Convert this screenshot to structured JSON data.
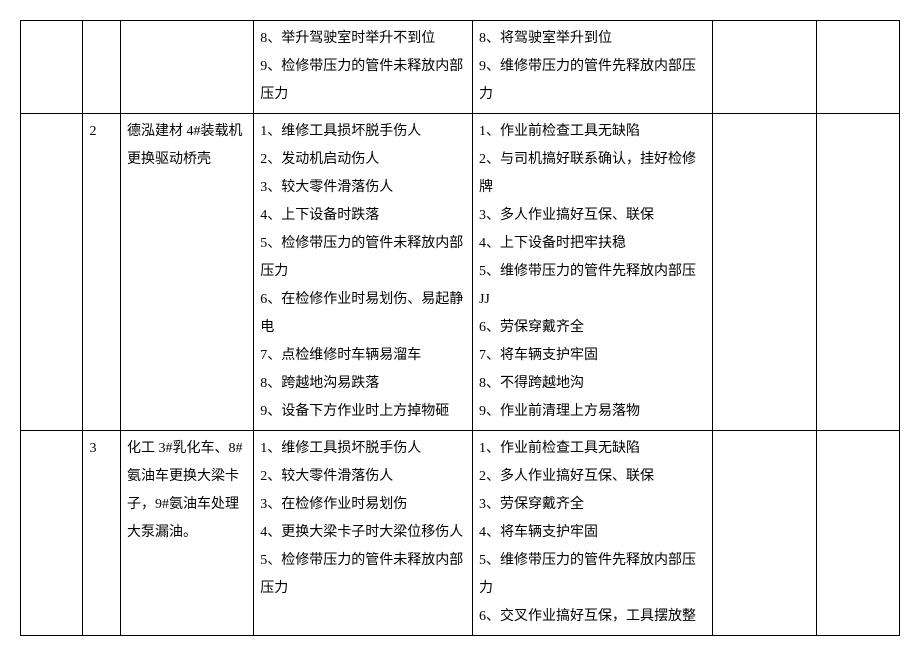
{
  "rows": [
    {
      "c0": "",
      "c1": "",
      "c2": "",
      "c3": "8、举升驾驶室时举升不到位\n9、检修带压力的管件未释放内部压力",
      "c4": "8、将驾驶室举升到位\n9、维修带压力的管件先释放内部压力",
      "c5": "",
      "c6": ""
    },
    {
      "c0": "",
      "c1": "2",
      "c2": "德泓建材 4#装载机更换驱动桥壳",
      "c3": "1、维修工具损坏脱手伤人\n2、发动机启动伤人\n3、较大零件滑落伤人\n4、上下设备时跌落\n5、检修带压力的管件未释放内部压力\n6、在检修作业时易划伤、易起静电\n7、点检维修时车辆易溜车\n8、跨越地沟易跌落\n9、设备下方作业时上方掉物砸",
      "c4": "1、作业前检查工具无缺陷\n2、与司机搞好联系确认，挂好检修牌\n3、多人作业搞好互保、联保\n4、上下设备时把牢扶稳\n5、维修带压力的管件先释放内部压 JJ\n6、劳保穿戴齐全\n7、将车辆支护牢固\n8、不得跨越地沟\n9、作业前清理上方易落物",
      "c5": "",
      "c6": ""
    },
    {
      "c0": "",
      "c1": "3",
      "c2": "化工 3#乳化车、8#氨油车更换大梁卡子，9#氨油车处理大泵漏油。",
      "c3": "1、维修工具损坏脱手伤人\n2、较大零件滑落伤人\n3、在检修作业时易划伤\n4、更换大梁卡子时大梁位移伤人\n5、检修带压力的管件未释放内部压力",
      "c4": "1、作业前检查工具无缺陷\n2、多人作业搞好互保、联保\n3、劳保穿戴齐全\n4、将车辆支护牢固\n5、维修带压力的管件先释放内部压力\n6、交叉作业搞好互保，工具摆放整",
      "c5": "",
      "c6": ""
    }
  ]
}
